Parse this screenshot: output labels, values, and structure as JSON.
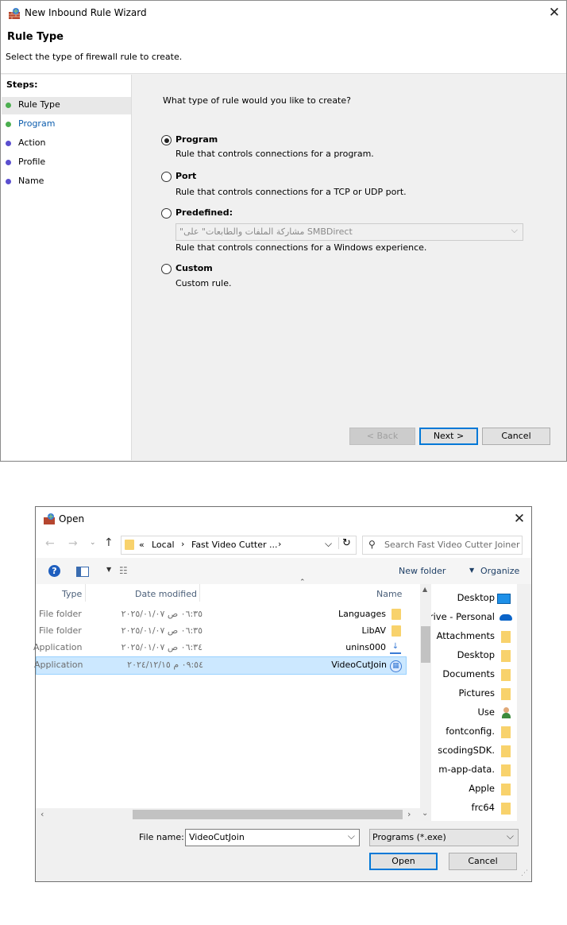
{
  "wizard": {
    "title": "New Inbound Rule Wizard",
    "heading": "Rule Type",
    "subheading": "Select the type of firewall rule to create.",
    "steps_title": "Steps:",
    "steps": [
      {
        "label": "Rule Type",
        "color": "#4caf50",
        "active": true
      },
      {
        "label": "Program",
        "color": "#4caf50",
        "link": true
      },
      {
        "label": "Action",
        "color": "#5b4fcf"
      },
      {
        "label": "Profile",
        "color": "#5b4fcf"
      },
      {
        "label": "Name",
        "color": "#5b4fcf"
      }
    ],
    "question": "What type of rule would you like to create?",
    "options": [
      {
        "title": "Program",
        "desc": "Rule that controls connections for a program.",
        "checked": true
      },
      {
        "title": "Port",
        "desc": "Rule that controls connections for a TCP or UDP port."
      },
      {
        "title": "Predefined:",
        "desc": "Rule that controls connections for a Windows experience."
      },
      {
        "title": "Custom",
        "desc": "Custom rule."
      }
    ],
    "predefined_value": "\"مشاركة الملفات والطابعات\" على SMBDirect",
    "buttons": {
      "back": "< Back",
      "next": "Next >",
      "cancel": "Cancel"
    }
  },
  "open_dialog": {
    "title": "Open",
    "breadcrumb": [
      "«",
      "Local",
      "›",
      "Fast Video Cutter ...",
      "›"
    ],
    "search_placeholder": "Search Fast Video Cutter Joiner",
    "new_folder": "New folder",
    "organize": "Organize",
    "columns": {
      "name": "Name",
      "date": "Date modified",
      "type": "Type"
    },
    "files": [
      {
        "name": "Languages",
        "date": "٠٦:٣٥ ص ٢٠٢٥/٠١/٠٧",
        "type": "File folder",
        "icon": "folder-icon"
      },
      {
        "name": "LibAV",
        "date": "٠٦:٣٥ ص ٢٠٢٥/٠١/٠٧",
        "type": "File folder",
        "icon": "folder-icon"
      },
      {
        "name": "unins000",
        "date": "٠٦:٣٤ ص ٢٠٢٥/٠١/٠٧",
        "type": "Application",
        "icon": "installer-icon"
      },
      {
        "name": "VideoCutJoin",
        "date": "٠٩:٥٤ م ٢٠٢٤/١٢/١٥",
        "type": "Application",
        "icon": "app-icon",
        "selected": true
      }
    ],
    "nav_items": [
      {
        "label": "Desktop",
        "icon": "desktop-icon"
      },
      {
        "label": "rive - Personal",
        "icon": "onedrive-icon"
      },
      {
        "label": "Attachments",
        "icon": "folder-icon"
      },
      {
        "label": "Desktop",
        "icon": "folder-icon"
      },
      {
        "label": "Documents",
        "icon": "folder-icon"
      },
      {
        "label": "Pictures",
        "icon": "folder-icon"
      },
      {
        "label": "Use",
        "icon": "user-icon"
      },
      {
        "label": "fontconfig.",
        "icon": "folder-icon"
      },
      {
        "label": "scodingSDK.",
        "icon": "folder-icon"
      },
      {
        "label": "m-app-data.",
        "icon": "folder-icon"
      },
      {
        "label": "Apple",
        "icon": "folder-icon"
      },
      {
        "label": "frc64",
        "icon": "folder-icon"
      }
    ],
    "filename_label": "File name:",
    "filename_value": "VideoCutJoin",
    "filetype_value": "Programs (*.exe)",
    "buttons": {
      "open": "Open",
      "cancel": "Cancel"
    }
  }
}
